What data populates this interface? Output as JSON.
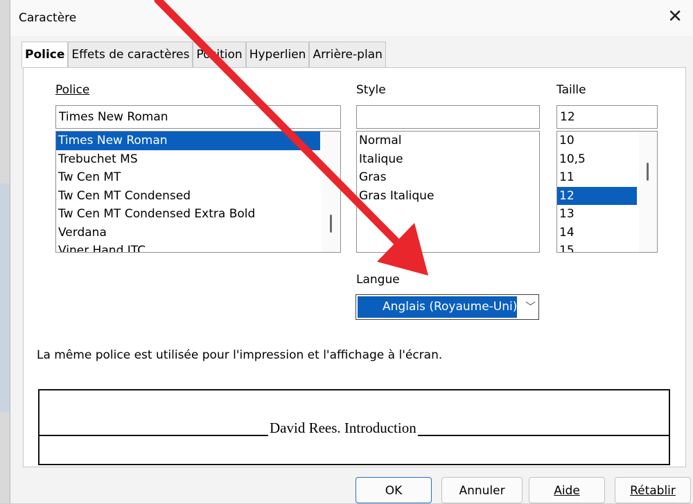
{
  "dialog": {
    "title": "Caractère"
  },
  "tabs": [
    "Police",
    "Effets de caractères",
    "Position",
    "Hyperlien",
    "Arrière-plan"
  ],
  "font": {
    "label": "Police",
    "value": "Times New Roman",
    "list": [
      "Times New Roman",
      "Trebuchet MS",
      "Tw Cen MT",
      "Tw Cen MT Condensed",
      "Tw Cen MT Condensed Extra Bold",
      "Verdana",
      "Viner Hand ITC"
    ],
    "selected_index": 0
  },
  "style": {
    "label": "Style",
    "value": "",
    "list": [
      "Normal",
      "Italique",
      "Gras",
      "Gras Italique"
    ]
  },
  "size": {
    "label": "Taille",
    "value": "12",
    "list": [
      "10",
      "10,5",
      "11",
      "12",
      "13",
      "14",
      "15"
    ],
    "selected_index": 3
  },
  "language": {
    "label": "Langue",
    "value": "Anglais (Royaume-Uni)"
  },
  "note": "La même police est utilisée pour l'impression et l'affichage à l'écran.",
  "preview_text": "David Rees. Introduction",
  "buttons": {
    "ok": "OK",
    "cancel": "Annuler",
    "help": "Aide",
    "reset": "Rétablir"
  },
  "colors": {
    "accent": "#0a5fbd",
    "annotation_arrow": "#e8262b"
  }
}
